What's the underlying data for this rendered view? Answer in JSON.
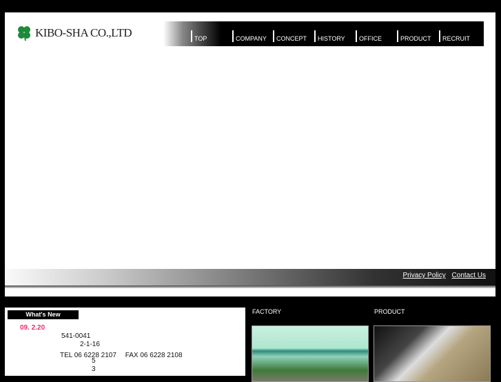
{
  "logo": {
    "text": "KIBO-SHA CO.,LTD"
  },
  "nav": [
    {
      "label": "TOP"
    },
    {
      "label": "COMPANY"
    },
    {
      "label": "CONCEPT"
    },
    {
      "label": "HISTORY"
    },
    {
      "label": "OFFICE"
    },
    {
      "label": "PRODUCT"
    },
    {
      "label": "RECRUIT"
    }
  ],
  "footer_links": {
    "privacy": "Privacy Policy",
    "contact": "Contact Us"
  },
  "news": {
    "title": "What's New",
    "date": "09. 2.20",
    "lines": [
      "541-0041",
      "2-1-16",
      "TEL 06 6228 2107　 FAX 06 6228 2108",
      "5",
      "3"
    ]
  },
  "sections": {
    "factory": "FACTORY",
    "product": "PRODUCT"
  },
  "colors": {
    "accent": "#e8306a",
    "clover": "#1e8a3a"
  }
}
